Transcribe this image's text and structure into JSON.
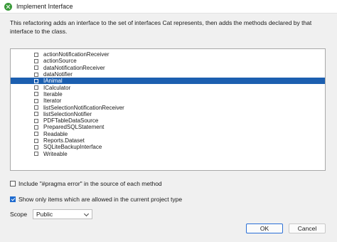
{
  "window": {
    "title": "Implement Interface"
  },
  "description": "This refactoring adds an interface to the set of interfaces Cat represents, then adds the methods declared by that interface to the class.",
  "interfaces": [
    {
      "label": "actionNotificationReceiver",
      "checked": false,
      "selected": false
    },
    {
      "label": "actionSource",
      "checked": false,
      "selected": false
    },
    {
      "label": "dataNotificationReceiver",
      "checked": false,
      "selected": false
    },
    {
      "label": "dataNotifier",
      "checked": false,
      "selected": false
    },
    {
      "label": "IAnimal",
      "checked": true,
      "selected": true
    },
    {
      "label": "ICalculator",
      "checked": false,
      "selected": false
    },
    {
      "label": "Iterable",
      "checked": false,
      "selected": false
    },
    {
      "label": "Iterator",
      "checked": false,
      "selected": false
    },
    {
      "label": "listSelectionNotificationReceiver",
      "checked": false,
      "selected": false
    },
    {
      "label": "listSelectionNotifier",
      "checked": false,
      "selected": false
    },
    {
      "label": "PDFTableDataSource",
      "checked": false,
      "selected": false
    },
    {
      "label": "PreparedSQLStatement",
      "checked": false,
      "selected": false
    },
    {
      "label": "Readable",
      "checked": false,
      "selected": false
    },
    {
      "label": "Reports.Dataset",
      "checked": false,
      "selected": false
    },
    {
      "label": "SQLiteBackupInterface",
      "checked": false,
      "selected": false
    },
    {
      "label": "Writeable",
      "checked": false,
      "selected": false
    }
  ],
  "options": {
    "pragma_error": {
      "label": "Include \"#pragma error\" in the source of each method",
      "checked": false
    },
    "only_allowed": {
      "label": "Show only items which are allowed in the current project type",
      "checked": true
    }
  },
  "scope": {
    "label": "Scope",
    "value": "Public"
  },
  "buttons": {
    "ok": "OK",
    "cancel": "Cancel"
  }
}
